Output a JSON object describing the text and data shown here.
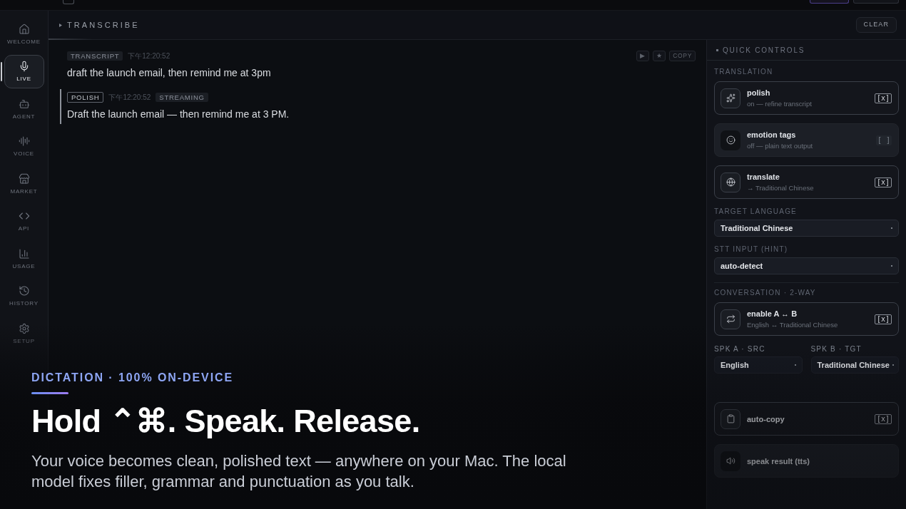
{
  "sidebar": {
    "items": [
      {
        "label": "WELCOME",
        "selected": false
      },
      {
        "label": "LIVE",
        "selected": true
      },
      {
        "label": "AGENT",
        "selected": false
      },
      {
        "label": "VOICE",
        "selected": false
      },
      {
        "label": "MARKET",
        "selected": false
      },
      {
        "label": "API",
        "selected": false
      },
      {
        "label": "USAGE",
        "selected": false
      },
      {
        "label": "HISTORY",
        "selected": false
      },
      {
        "label": "SETUP",
        "selected": false
      }
    ]
  },
  "header": {
    "title": "TRANSCRIBE",
    "clear_button": "CLEAR"
  },
  "entries": [
    {
      "kind": "transcript",
      "tag": "TRANSCRIPT",
      "time": "下午12:20:52",
      "text": "draft the launch email, then remind me at 3pm",
      "actions": [
        "▶",
        "★",
        "COPY"
      ]
    },
    {
      "kind": "polish",
      "tag": "POLISH",
      "time": "下午12:20:52",
      "status": "STREAMING",
      "text": "Draft the launch email — then remind me at 3 PM."
    }
  ],
  "quick_controls": {
    "title": "QUICK CONTROLS",
    "blocks": [
      {
        "kind": "label",
        "text": "TRANSLATION"
      },
      {
        "kind": "toggle",
        "title": "polish",
        "subtitle": "on — refine transcript",
        "on": true,
        "mark": "[x]"
      },
      {
        "kind": "toggle",
        "title": "emotion tags",
        "subtitle": "off — plain text output",
        "on": false,
        "mark": "[ ]"
      },
      {
        "kind": "toggle",
        "title": "translate",
        "subtitle": "→ Traditional Chinese",
        "on": true,
        "mark": "[x]"
      },
      {
        "kind": "label",
        "text": "TARGET LANGUAGE"
      },
      {
        "kind": "select",
        "value": "Traditional Chinese"
      },
      {
        "kind": "label",
        "text": "STT INPUT (HINT)"
      },
      {
        "kind": "select",
        "value": "auto-detect"
      },
      {
        "kind": "label",
        "text": "CONVERSATION · 2-WAY",
        "rule": true
      },
      {
        "kind": "toggle",
        "title": "enable A ↔ B",
        "subtitle": "English ↔ Traditional Chinese",
        "on": true,
        "mark": "[x]"
      },
      {
        "kind": "pair",
        "items": [
          {
            "label": "SPK A · SRC",
            "value": "English"
          },
          {
            "label": "SPK B · TGT",
            "value": "Traditional Chinese"
          }
        ]
      },
      {
        "kind": "toggle",
        "title": "auto-copy",
        "on": true,
        "mark": "[x]"
      },
      {
        "kind": "toggle",
        "title": "speak result (tts)",
        "on": false
      }
    ]
  },
  "caption": {
    "eyebrow": "DICTATION · 100% ON-DEVICE",
    "heading": "Hold ⌃⌘. Speak. Release.",
    "body": "Your voice becomes clean, polished text — anywhere on your Mac. The local model fixes filler, grammar and punctuation as you talk."
  }
}
